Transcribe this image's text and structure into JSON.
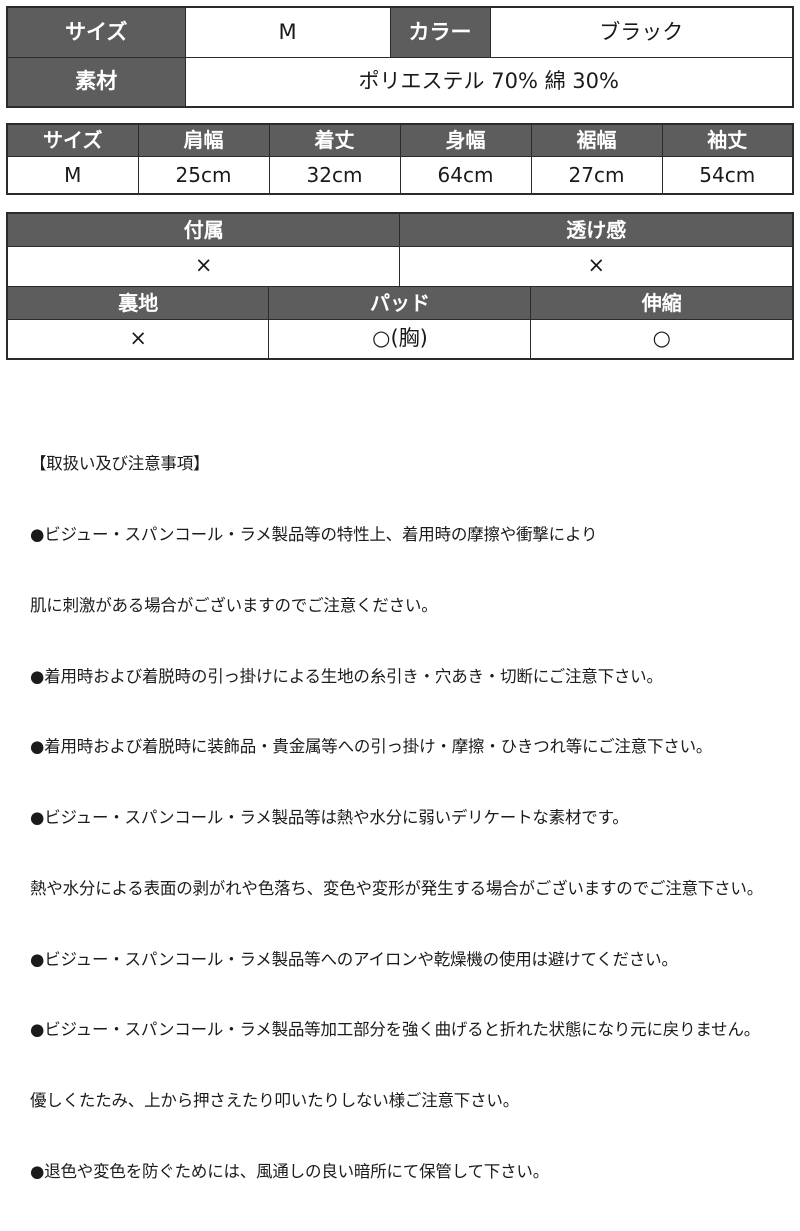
{
  "basic_table": {
    "rows": [
      {
        "cells": [
          {
            "text": "サイズ",
            "type": "header"
          },
          {
            "text": "M",
            "type": "value"
          },
          {
            "text": "カラー",
            "type": "header"
          },
          {
            "text": "ブラック",
            "type": "value"
          }
        ]
      },
      {
        "cells": [
          {
            "text": "素材",
            "type": "header"
          },
          {
            "text": "ポリエステル 70%  綿 30%",
            "type": "value"
          }
        ]
      }
    ]
  },
  "measure_table": {
    "headers": [
      "サイズ",
      "肩幅",
      "着丈",
      "身幅",
      "裾幅",
      "袖丈"
    ],
    "values": [
      "M",
      "25cm",
      "32cm",
      "64cm",
      "27cm",
      "54cm"
    ]
  },
  "features_table": {
    "section_one": {
      "headers": [
        "付属",
        "透け感"
      ],
      "values": [
        "×",
        "×"
      ]
    },
    "section_two": {
      "headers": [
        "裏地",
        "パッド",
        "伸縮"
      ],
      "values": [
        "×",
        "○(胸)",
        "○"
      ]
    }
  },
  "notes": {
    "title": "【取扱い及び注意事項】",
    "lines": [
      "●ビジュー・スパンコール・ラメ製品等の特性上、着用時の摩擦や衝撃により",
      "肌に刺激がある場合がございますのでご注意ください。",
      "●着用時および着脱時の引っ掛けによる生地の糸引き・穴あき・切断にご注意下さい。",
      "●着用時および着脱時に装飾品・貴金属等への引っ掛け・摩擦・ひきつれ等にご注意下さい。",
      "●ビジュー・スパンコール・ラメ製品等は熱や水分に弱いデリケートな素材です。",
      "熱や水分による表面の剥がれや色落ち、変色や変形が発生する場合がございますのでご注意下さい。",
      "●ビジュー・スパンコール・ラメ製品等へのアイロンや乾燥機の使用は避けてください。",
      "●ビジュー・スパンコール・ラメ製品等加工部分を強く曲げると折れた状態になり元に戻りません。",
      "優しくたたみ、上から押さえたり叩いたりしない様ご注意下さい。",
      "●退色や変色を防ぐためには、風通しの良い暗所にて保管して下さい。"
    ]
  },
  "colors": {
    "header_bg": "#5d5d5d",
    "header_text": "#ffffff",
    "border": "#2b2b2b",
    "body_text": "#1a1a1a",
    "page_bg": "#ffffff"
  }
}
